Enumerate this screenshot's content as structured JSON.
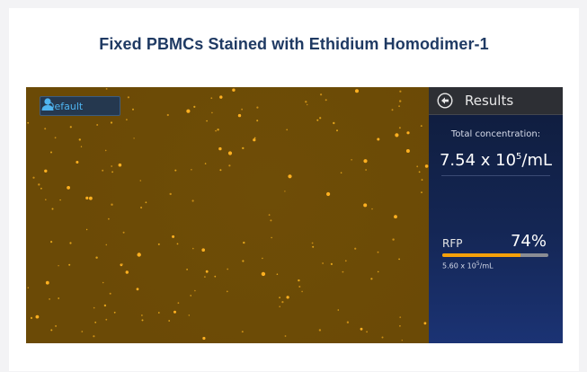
{
  "card": {
    "title": "Fixed PBMCs Stained with Ethidium Homodimer-1"
  },
  "viewer": {
    "profile_button": {
      "label": "Default",
      "icon": "user-icon"
    },
    "image": {
      "description_colors": {
        "background": "#6b4a06",
        "cells": "#ffb020"
      }
    }
  },
  "results": {
    "header": {
      "back_icon": "back-arrow-icon",
      "title": "Results"
    },
    "total": {
      "label": "Total concentration:",
      "mantissa": "7.54 x 10",
      "exponent": "5",
      "unit": "/mL"
    },
    "channel": {
      "name": "RFP",
      "percent": "74%",
      "fraction": 0.74,
      "bar_color": "#f5a10a",
      "conc_mantissa": "5.60 x 10",
      "conc_exponent": "5",
      "conc_unit": "/mL"
    }
  }
}
